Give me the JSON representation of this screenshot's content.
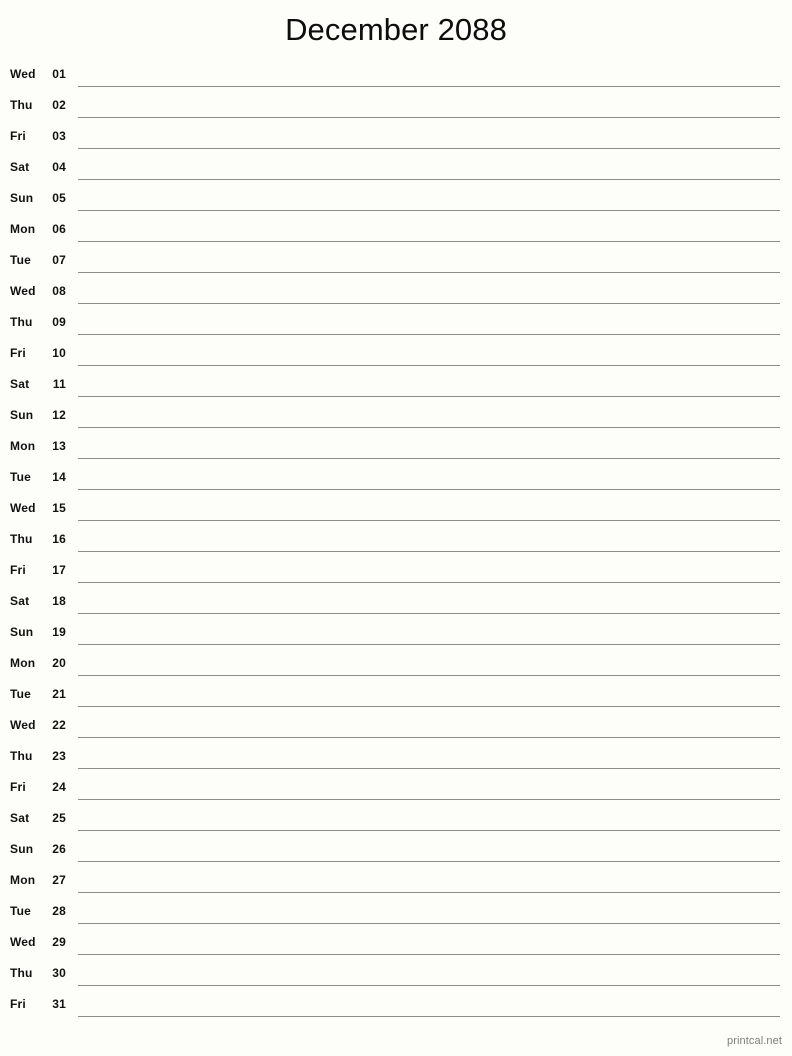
{
  "document": {
    "title": "December 2088",
    "month": "December",
    "year": "2088",
    "layout": "single-column-notepad",
    "page_background": "#fdfdfa",
    "rule_color": "#8c8c8c",
    "text_color": "#111111"
  },
  "footer": {
    "brand": "printcal.net",
    "color": "#7d7d7d"
  },
  "days": [
    {
      "dow": "Wed",
      "date": "01"
    },
    {
      "dow": "Thu",
      "date": "02"
    },
    {
      "dow": "Fri",
      "date": "03"
    },
    {
      "dow": "Sat",
      "date": "04"
    },
    {
      "dow": "Sun",
      "date": "05"
    },
    {
      "dow": "Mon",
      "date": "06"
    },
    {
      "dow": "Tue",
      "date": "07"
    },
    {
      "dow": "Wed",
      "date": "08"
    },
    {
      "dow": "Thu",
      "date": "09"
    },
    {
      "dow": "Fri",
      "date": "10"
    },
    {
      "dow": "Sat",
      "date": "11"
    },
    {
      "dow": "Sun",
      "date": "12"
    },
    {
      "dow": "Mon",
      "date": "13"
    },
    {
      "dow": "Tue",
      "date": "14"
    },
    {
      "dow": "Wed",
      "date": "15"
    },
    {
      "dow": "Thu",
      "date": "16"
    },
    {
      "dow": "Fri",
      "date": "17"
    },
    {
      "dow": "Sat",
      "date": "18"
    },
    {
      "dow": "Sun",
      "date": "19"
    },
    {
      "dow": "Mon",
      "date": "20"
    },
    {
      "dow": "Tue",
      "date": "21"
    },
    {
      "dow": "Wed",
      "date": "22"
    },
    {
      "dow": "Thu",
      "date": "23"
    },
    {
      "dow": "Fri",
      "date": "24"
    },
    {
      "dow": "Sat",
      "date": "25"
    },
    {
      "dow": "Sun",
      "date": "26"
    },
    {
      "dow": "Mon",
      "date": "27"
    },
    {
      "dow": "Tue",
      "date": "28"
    },
    {
      "dow": "Wed",
      "date": "29"
    },
    {
      "dow": "Thu",
      "date": "30"
    },
    {
      "dow": "Fri",
      "date": "31"
    }
  ]
}
